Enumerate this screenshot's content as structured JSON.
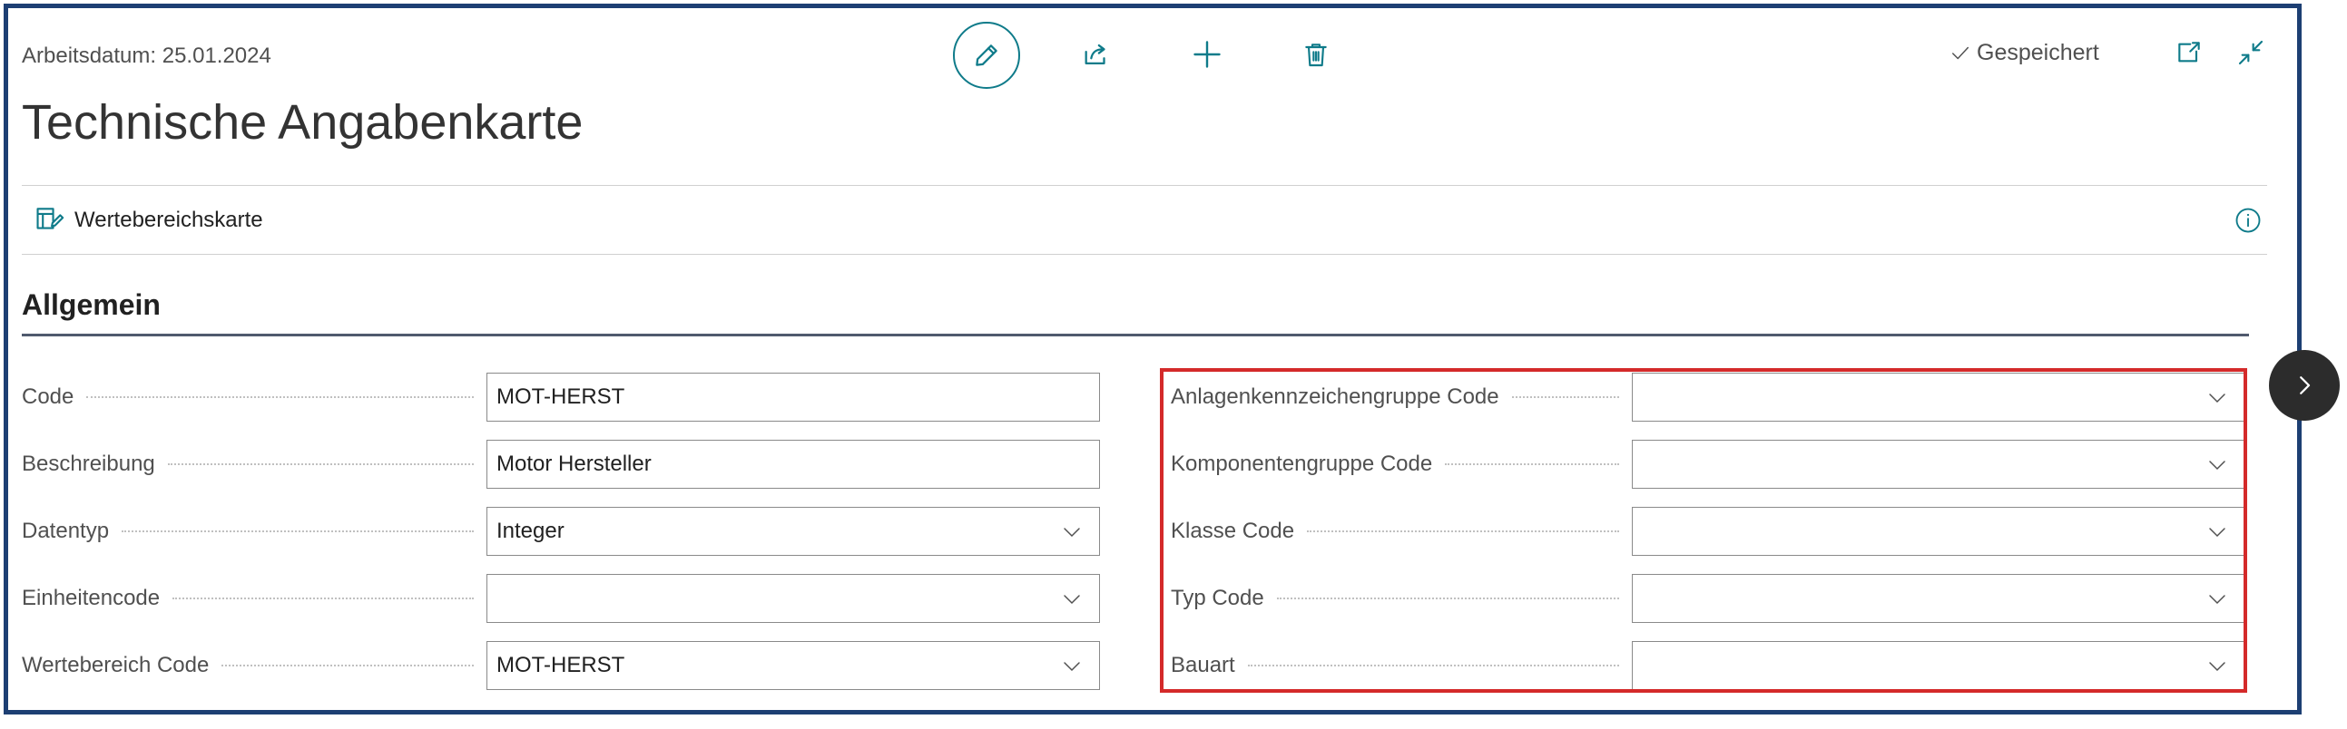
{
  "header": {
    "work_date": "Arbeitsdatum: 25.01.2024",
    "title": "Technische Angabenkarte",
    "saved_status": "Gespeichert"
  },
  "toolbar": {
    "icons": [
      "edit-pencil-icon",
      "share-icon",
      "add-icon",
      "delete-icon"
    ]
  },
  "actions": {
    "value_range_card": "Wertebereichskarte"
  },
  "section": {
    "title": "Allgemein"
  },
  "left_fields": [
    {
      "label": "Code",
      "value": "MOT-HERST",
      "type": "text"
    },
    {
      "label": "Beschreibung",
      "value": "Motor Hersteller",
      "type": "text"
    },
    {
      "label": "Datentyp",
      "value": "Integer",
      "type": "select"
    },
    {
      "label": "Einheitencode",
      "value": "",
      "type": "select"
    },
    {
      "label": "Wertebereich Code",
      "value": "MOT-HERST",
      "type": "select"
    }
  ],
  "right_fields": [
    {
      "label": "Anlagenkennzeichengruppe Code",
      "value": "",
      "type": "select"
    },
    {
      "label": "Komponentengruppe Code",
      "value": "",
      "type": "select"
    },
    {
      "label": "Klasse Code",
      "value": "",
      "type": "select"
    },
    {
      "label": "Typ Code",
      "value": "",
      "type": "select"
    },
    {
      "label": "Bauart",
      "value": "",
      "type": "select"
    }
  ],
  "colors": {
    "frame": "#1d3f73",
    "accent": "#0f7b8a",
    "highlight": "#d42a2a",
    "next_button": "#2c2c2c"
  }
}
